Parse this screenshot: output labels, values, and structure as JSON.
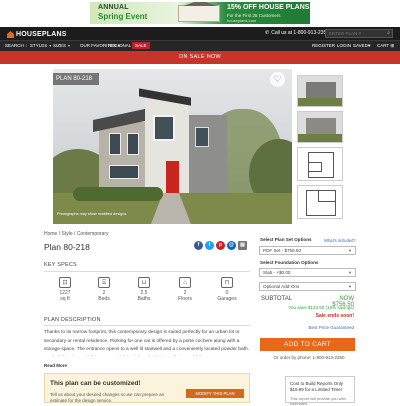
{
  "promo_banner": {
    "line1": "ANNUAL",
    "line2": "Spring Event",
    "headline": "15% OFF HOUSE PLANS",
    "subline": "For the First 25 Customers",
    "fineprint": "houseplans.com"
  },
  "header": {
    "brand": "HOUSEPLANS",
    "phone": "Call us at 1-800-913-2350",
    "search_placeholder": "ENTER PLAN #",
    "nav": [
      "SEARCH",
      "STYLES",
      "SIZES",
      "OUR FAVORITES",
      "REGIONAL",
      "SALE"
    ],
    "right_nav": [
      "REGISTER",
      "LOGIN",
      "SAVED",
      "CART"
    ]
  },
  "sale_bar": "ON SALE NOW",
  "hero": {
    "badge": "PLAN 80-218",
    "caption": "Photographs may show modified designs."
  },
  "breadcrumb": [
    "Home",
    "Style",
    "Contemporary"
  ],
  "plan_title": "Plan 80-218",
  "key_specs": {
    "heading": "KEY SPECS",
    "items": [
      {
        "icon": "area-icon",
        "value": "1227",
        "unit": "sq ft"
      },
      {
        "icon": "bed-icon",
        "value": "2",
        "unit": "Beds"
      },
      {
        "icon": "bath-icon",
        "value": "2.5",
        "unit": "Baths"
      },
      {
        "icon": "floors-icon",
        "value": "2",
        "unit": "Floors"
      },
      {
        "icon": "garage-icon",
        "value": "0",
        "unit": "Garages"
      }
    ]
  },
  "description": {
    "heading": "PLAN DESCRIPTION",
    "text": "Thanks to its narrow footprint, this contemporary design is suited perfectly for an urban lot or secondary or rental residence. Parking for one car is offered by a porte cochere along with a storage space. The entrance opens to a well lit stairwell and a conveniently located powder bath. To the left is the main living area which includes the kitchen, dining and living room.",
    "read_more": "Read More"
  },
  "customize": {
    "heading": "This plan can be customized!",
    "sub": "Tell us about your desired changes so we can prepare an estimate for the design service.",
    "button": "MODIFY THIS PLAN"
  },
  "purchase": {
    "set_label": "Select Plan Set Options",
    "set_link": "What's included?",
    "set_value": "PDF Set - $756.50",
    "foundation_label": "Select Foundation Options",
    "foundation_value": "Slab - +$0.00",
    "addon_value": "Optional Add-Ons",
    "subtotal_label": "SUBTOTAL",
    "subtotal_value": "NOW $756.50",
    "save_text": "You save $133.50 (15% savings)",
    "ends": "Sale ends soon!",
    "guarantee": "Best Price Guaranteed",
    "add_to_cart": "ADD TO CART",
    "order_phone": "Or order by phone: 1-800-913-2350"
  },
  "cost_box": {
    "text": "Cost to Build Reports Only $19.99 for a Limited Time!",
    "sub": "This report will provide you with estimates"
  },
  "colors": {
    "accent_orange": "#e8681a",
    "sale_red": "#c7342a",
    "price_green": "#3a9c3a"
  }
}
